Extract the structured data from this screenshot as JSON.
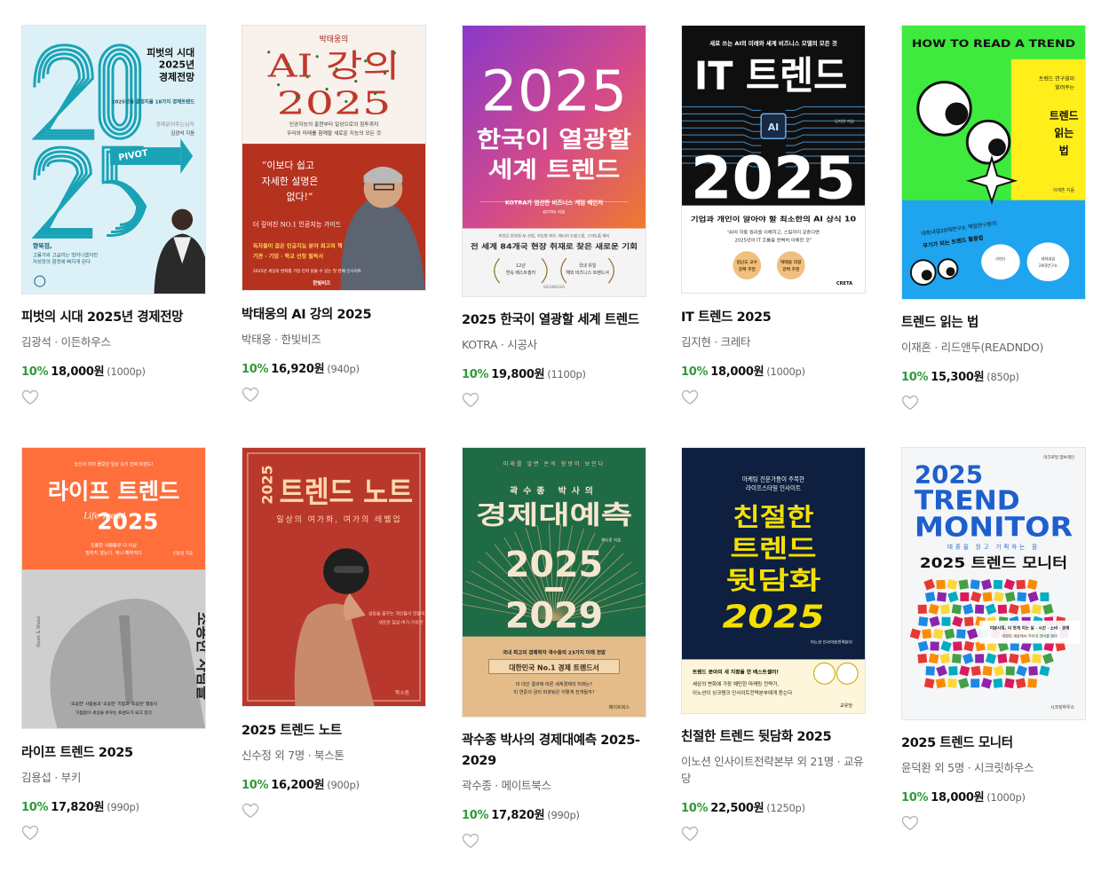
{
  "books": [
    {
      "title": "피벗의 시대 2025년 경제전망",
      "author": "김광석",
      "publisher": "이든하우스",
      "discount": "10%",
      "price": "18,000",
      "currency": "원",
      "points": "(1000p)",
      "cover": {
        "bg": "#dcf1f7",
        "accent": "#1aa3b6",
        "big": "20 25",
        "t1": "피벗의 시대",
        "t2": "2025년",
        "t3": "경제전망",
        "tag": "PIVOT",
        "sub": "2025년을 결정지을 18가지 경제트렌드",
        "note": "경제읽어주는남자",
        "author_line": "김광석 지음",
        "blurb": "향북점, 고물가와 고금리는 벗어나겠지만 지성장의 함정에 빠지게 된다"
      }
    },
    {
      "title": "박태웅의 AI 강의 2025",
      "author": "박태웅",
      "publisher": "한빛비즈",
      "discount": "10%",
      "price": "16,920",
      "currency": "원",
      "points": "(940p)",
      "cover": {
        "bg": "#f8f1ec",
        "accent": "#c0392b",
        "pre": "박태웅의",
        "t1": "AI 강의",
        "t2": "2025",
        "sub1": "인공지능의 출현부터 일상으로의 침투까지",
        "sub2": "우리와 미래를 함께할 새로운 지능의 모든 것",
        "quote1": "“이보다 쉽고",
        "quote2": "자세한 설명은",
        "quote3": "없다!”",
        "guide": "더 깊어진 NO.1 인공지능 가이드",
        "rec1": "독자들이 꼽은 인공지능 분야 최고의 책",
        "rec2": "기관 · 기업 · 학교 선정 필독서",
        "small": "2025년 세상의 변화를 가장 먼저 읽을 수 있는 첫 번째 인사이트",
        "pub": "한빛비즈"
      }
    },
    {
      "title": "2025 한국이 열광할 세계 트렌드",
      "author": "KOTRA",
      "publisher": "시공사",
      "discount": "10%",
      "price": "19,800",
      "currency": "원",
      "points": "(1100p)",
      "cover": {
        "bg_top": "#8a38c9",
        "bg_bottom": "#f07a2e",
        "t0": "2025",
        "t1": "한국이 열광할",
        "t2": "세계 트렌드",
        "sub": "KOTRA가 엄선한 비즈니스 게임 체인저",
        "author_line": "KOTRA 지음",
        "list": "미친은 한자원 AI 산업, 지능형 외우, 에너지 트렌스점, 스마트홈 제지",
        "headline": "전 세계 84개국 현장 취재로 찾은 새로운 기회",
        "award1a": "12년",
        "award1b": "연속 베스트셀러",
        "award2a": "국내 유일",
        "award2b": "해외 비즈니스 트렌드서",
        "pub": "SIGONGSA"
      }
    },
    {
      "title": "IT 트렌드 2025",
      "author": "김지현",
      "publisher": "크레타",
      "discount": "10%",
      "price": "18,000",
      "currency": "원",
      "points": "(1000p)",
      "cover": {
        "bg": "#0f0f0f",
        "top": "새로 쓰는 AI의 미래와 세계 비즈니스 모델의 모든 것",
        "t1": "IT 트렌드",
        "chip": "AI",
        "author_line": "김지현 지음",
        "t2": "2025",
        "sub": "기업과 개인이 알아야 할 최소한의 AI 상식 10",
        "quote": "“AI의 작동 원리를 이해하고, 스킬까지 갖춘다면 2025년의 IT 흐름을 완벽히 이해한 것”",
        "badge1": "김난도 교수 강력 추천",
        "badge2": "박태웅 의장 강력 추천",
        "pub": "CRETA"
      }
    },
    {
      "title": "트렌드 읽는 법",
      "author": "이재흔",
      "publisher": "리드앤두(READNDO)",
      "discount": "10%",
      "price": "15,300",
      "currency": "원",
      "points": "(850p)",
      "cover": {
        "top": "HOW TO READ A TREND",
        "pre1": "트렌드 연구원이",
        "pre2": "알려주는",
        "t1": "트렌드",
        "t2": "읽는",
        "t3": "법",
        "author_line": "이재흔 지음",
        "sub1": "대학내일20대연구소 책임연구원의",
        "sub2": "무기가 되는 트렌드 활용법",
        "bubble": "대학내일 20대연구소 소장 호영성 추천",
        "green": "#3dea3d",
        "yellow": "#ffee1a",
        "blue": "#1fa4ef"
      }
    },
    {
      "title": "라이프 트렌드 2025",
      "author": "김용섭",
      "publisher": "부키",
      "discount": "10%",
      "price": "17,820",
      "currency": "원",
      "points": "(990p)",
      "cover": {
        "top": "당신이 미처 몰랐던 일상 속의 진짜 트렌드!",
        "t1": "라이프 트렌드",
        "t2": "2025",
        "script": "Life Trend",
        "sub1": "조용한 사람들은 더 이상",
        "sub2": "말하지 않는다. 애니 해하지다",
        "author_line": "김용섭 지음",
        "vertical": "조용한 사람들",
        "side": "Quiet & Shout",
        "bottom": "'조용한' 사람들과 '조용한' 측험과 '조용한' 행동이 거침없이 세상을 바꾸는 트렌드가 되고 있다",
        "bg": "#ff6f3c"
      }
    },
    {
      "title": "2025 트렌드 노트",
      "author": "신수정 외 7명",
      "publisher": "북스톤",
      "discount": "10%",
      "price": "16,200",
      "currency": "원",
      "points": "(900p)",
      "cover": {
        "bg": "#b9382e",
        "t0": "2025",
        "t1": "트렌드 노트",
        "sub": "일상의 여가화, 여가의 레벨업",
        "side1": "성장을 꿈꾸는 개인들이 만들어가는",
        "side2": "새로운 일상·여가·가치관",
        "pub": "북스톤"
      }
    },
    {
      "title": "곽수종 박사의 경제대예측 2025-2029",
      "author": "곽수종",
      "publisher": "메이트북스",
      "discount": "10%",
      "price": "17,820",
      "currency": "원",
      "points": "(990p)",
      "cover": {
        "bg": "#1f6b46",
        "top": "미래를 알면 돈의 향방이 보인다",
        "pre": "곽수종 박사의",
        "t1": "경제대예측",
        "t2": "2025",
        "t3": "2029",
        "author_line": "곽수종 지음",
        "sub1": "국내 최고의 경제학자 곽수종의 23가지 미래 전망",
        "sub2": "대한민국 No.1 경제 트렌드서",
        "sub3": "미 대선 결과에 따른 세계경제의 미래는? 미 연준의 금리 피봇팅은 어떻게 전개될까?",
        "pub": "메이트북스"
      }
    },
    {
      "title": "친절한 트렌드 뒷담화 2025",
      "author": "이노션 인사이트전략본부 외 21명",
      "publisher": "교유당",
      "discount": "10%",
      "price": "22,500",
      "currency": "원",
      "points": "(1250p)",
      "cover": {
        "bg": "#0e1f3f",
        "top1": "마케팅 전문가들이 주목한",
        "top2": "라이프스타일 인사이트",
        "t1": "친절한",
        "t2": "트렌드",
        "t3": "뒷담화",
        "t4": "2025",
        "author_line": "이노션 인사이트전략본부",
        "sub1": "트렌드 분야의 새 지평을 연 베스트셀러!",
        "sub2": "세상의 변화에 가장 예민한 마케팅 전략가,",
        "sub3": "이노션의 싱크탱크 인사이트전략본부에게 듣는다",
        "badge1": "스테디셀러 트렌드서",
        "badge2": "독자들이 찾는 스테디",
        "pub": "교유당"
      }
    },
    {
      "title": "2025 트렌드 모니터",
      "author": "윤덕환 외 5명",
      "publisher": "시크릿하우스",
      "discount": "10%",
      "price": "18,000",
      "currency": "원",
      "points": "(1000p)",
      "cover": {
        "bg": "#f5f6f7",
        "top": "마크로밀 엠브레인",
        "t0": "2025",
        "t1": "TREND",
        "t2": "MONITOR",
        "sub": "대중을 읽고 기획하는 힘",
        "t3": "2025 트렌드 모니터",
        "tag1": "미분사회, 더 잣게 지는 일 · 시간 · 소비 · 관계",
        "tag2": "대한민 세상에서 각자의 의미를 찾다",
        "pub": "시크릿하우스",
        "blue": "#1d5fcf"
      }
    }
  ]
}
